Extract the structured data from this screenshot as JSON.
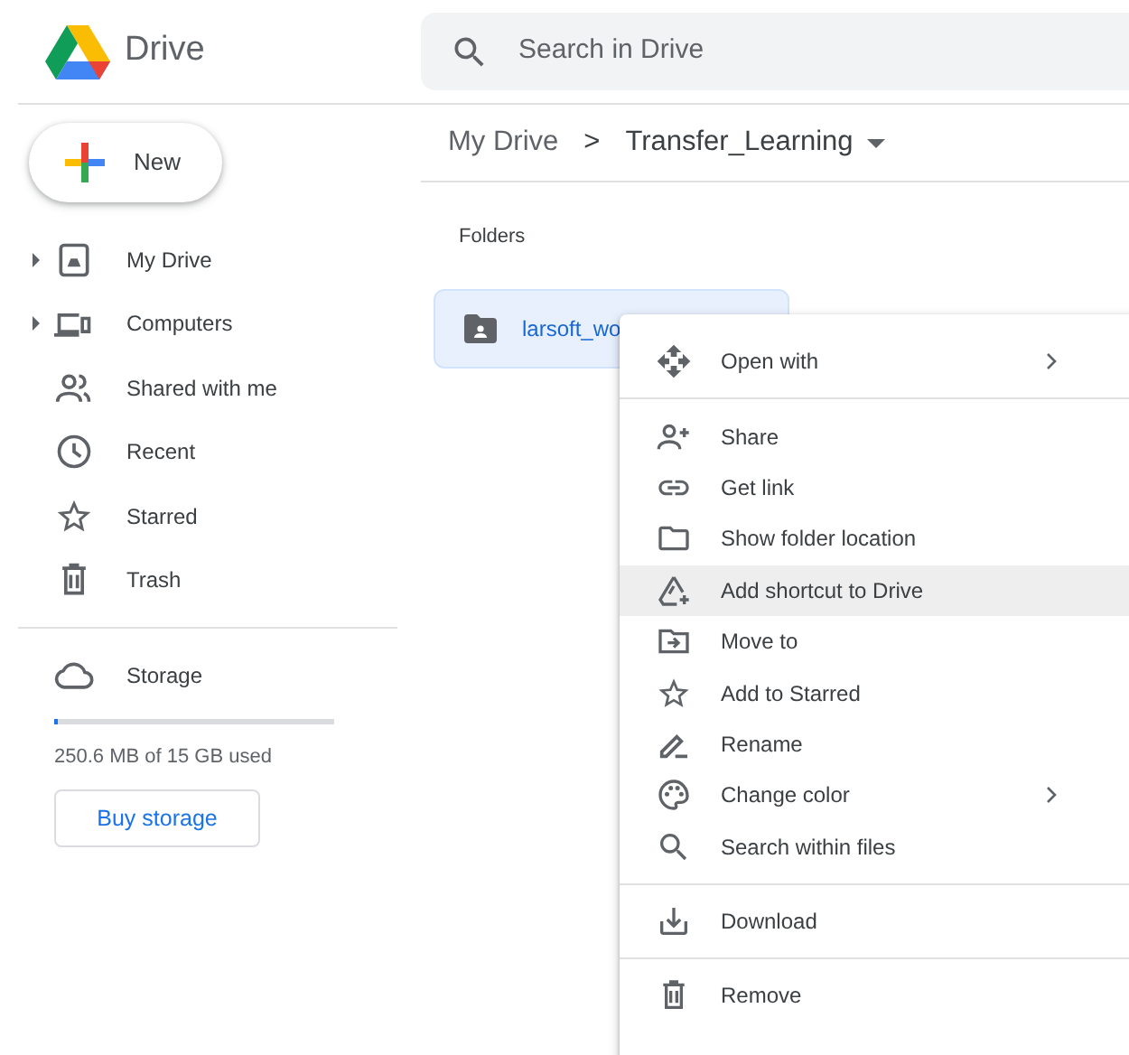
{
  "app": {
    "name": "Drive"
  },
  "search": {
    "placeholder": "Search in Drive"
  },
  "new_button": {
    "label": "New"
  },
  "sidebar": {
    "items": [
      {
        "label": "My Drive",
        "expandable": true
      },
      {
        "label": "Computers",
        "expandable": true
      },
      {
        "label": "Shared with me",
        "expandable": false
      },
      {
        "label": "Recent",
        "expandable": false
      },
      {
        "label": "Starred",
        "expandable": false
      },
      {
        "label": "Trash",
        "expandable": false
      }
    ]
  },
  "storage": {
    "label": "Storage",
    "level": 0.015,
    "usage": "250.6 MB of 15 GB used",
    "button": "Buy storage"
  },
  "breadcrumb": {
    "root": "My Drive",
    "separator": ">",
    "current": "Transfer_Learning"
  },
  "section_title": "Folders",
  "folders": [
    {
      "name": "larsoft_wo",
      "selected": true
    }
  ],
  "context_menu": {
    "groups": [
      [
        {
          "label": "Open with",
          "submenu": true,
          "selected": false
        }
      ],
      [
        {
          "label": "Share",
          "submenu": false,
          "selected": false
        },
        {
          "label": "Get link",
          "submenu": false,
          "selected": false
        },
        {
          "label": "Show folder location",
          "submenu": false,
          "selected": false
        },
        {
          "label": "Add shortcut to Drive",
          "submenu": false,
          "selected": true
        },
        {
          "label": "Move to",
          "submenu": false,
          "selected": false
        },
        {
          "label": "Add to Starred",
          "submenu": false,
          "selected": false
        },
        {
          "label": "Rename",
          "submenu": false,
          "selected": false
        },
        {
          "label": "Change color",
          "submenu": true,
          "selected": false
        },
        {
          "label": "Search within files",
          "submenu": false,
          "selected": false
        }
      ],
      [
        {
          "label": "Download",
          "submenu": false,
          "selected": false
        }
      ],
      [
        {
          "label": "Remove",
          "submenu": false,
          "selected": false
        }
      ]
    ]
  }
}
